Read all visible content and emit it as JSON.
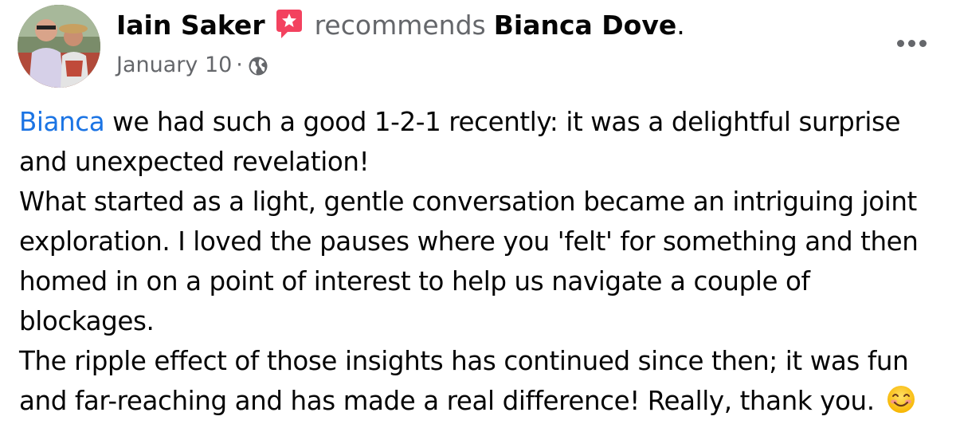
{
  "post": {
    "author": "Iain Saker",
    "verb": "recommends",
    "target": "Bianca Dove",
    "period": ".",
    "date": "January 10",
    "separator": "·",
    "privacy_icon": "globe-icon",
    "recommend_icon": "recommendation-star-icon",
    "menu_icon": "more-horizontal-icon",
    "lines": [
      {
        "mention": "Bianca",
        "text": " we had such a good 1-2-1 recently: it was a delightful surprise"
      },
      {
        "text": "and unexpected revelation!"
      },
      {
        "text": "What started as a light, gentle conversation became an intriguing joint"
      },
      {
        "text": "exploration. I loved the pauses where you 'felt' for something and then"
      },
      {
        "text": "homed in on a point of interest to help us navigate a couple of"
      },
      {
        "text": "blockages."
      },
      {
        "text": "The ripple effect of those insights has continued since then; it was fun"
      },
      {
        "text": "and far-reaching and has made a real difference! Really, thank you.",
        "emoji": "smiling-face-emoji"
      }
    ]
  },
  "colors": {
    "link_blue": "#1b74e4",
    "secondary_text": "#65676b",
    "primary_text": "#050505",
    "recommend_red": "#f3425f"
  }
}
